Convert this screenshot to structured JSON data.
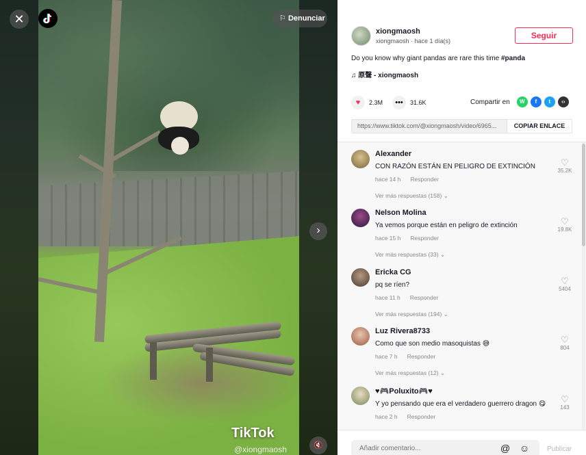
{
  "video": {
    "report_label": "Denunciar",
    "watermark_text": "TikTok",
    "watermark_handle": "@xiongmaosh",
    "close_icon": "close-icon",
    "next_icon": "chevron-right-icon",
    "mute_icon": "mute-icon"
  },
  "author": {
    "username": "xiongmaosh",
    "subline": "xiongmaosh · hace 1 día(s)",
    "follow_label": "Seguir"
  },
  "post": {
    "description": "Do you know why giant pandas are rare this time ",
    "hashtag": "#panda",
    "music": "原聲 - xiongmaosh"
  },
  "stats": {
    "likes": "2.3M",
    "comments": "31.6K"
  },
  "share": {
    "label": "Compartir en",
    "url": "https://www.tiktok.com/@xiongmaosh/video/6965...",
    "copy_label": "COPIAR ENLACE"
  },
  "comments": [
    {
      "name": "Alexander",
      "text": "CON RAZÓN ESTÁN EN PELIGRO DE EXTINCIÓN",
      "time": "hace 14 h",
      "reply": "Responder",
      "replies": "Ver más respuestas (158)",
      "likes": "35.2K"
    },
    {
      "name": "Nelson Molina",
      "text": "Ya vemos porque están en peligro de extinción",
      "time": "hace 15 h",
      "reply": "Responder",
      "replies": "Ver más respuestas (33)",
      "likes": "19.8K"
    },
    {
      "name": "Ericka CG",
      "text": "pq se ríen?",
      "time": "hace 11 h",
      "reply": "Responder",
      "replies": "Ver más respuestas (194)",
      "likes": "5404"
    },
    {
      "name": "Luz Rivera8733",
      "text": "Como que son medio masoquistas 😅",
      "time": "hace 7 h",
      "reply": "Responder",
      "replies": "Ver más respuestas (12)",
      "likes": "804"
    },
    {
      "name": "♥🎮Poluxito🎮♥",
      "text": "Y yo pensando que era el verdadero guerrero dragon 😋",
      "time": "hace 2 h",
      "reply": "Responder",
      "replies": "",
      "likes": "143"
    }
  ],
  "compose": {
    "placeholder": "Añadir comentario...",
    "post_label": "Publicar"
  },
  "colors": {
    "accent": "#fe2c55",
    "whatsapp": "#25d366",
    "facebook": "#1877f2",
    "twitter": "#1da1f2",
    "embed": "#333333"
  }
}
